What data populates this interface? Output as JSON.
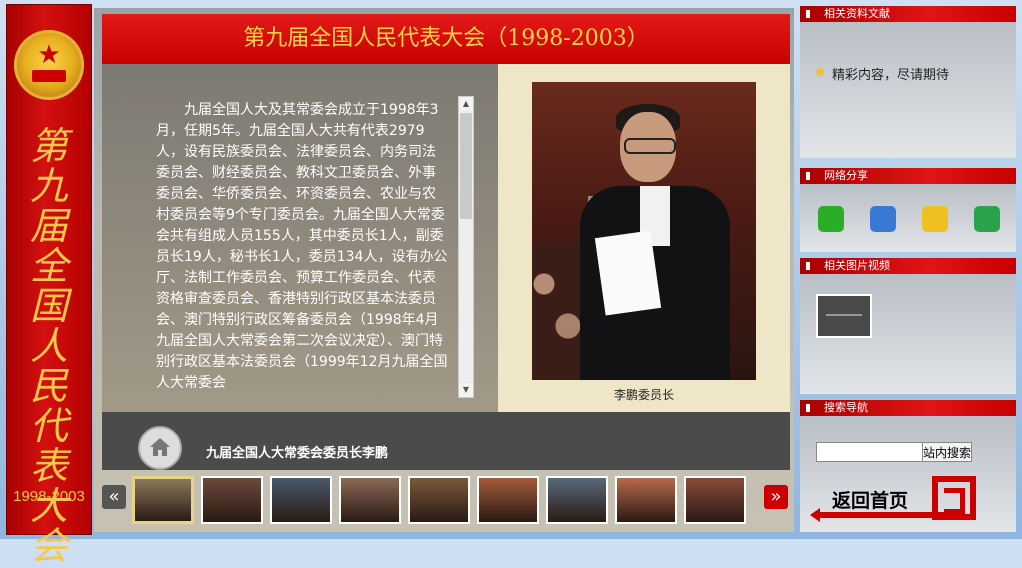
{
  "banner": {
    "vertical_title": [
      "第",
      "九",
      "届",
      "全",
      "国",
      "人",
      "民",
      "代",
      "表",
      "大",
      "会"
    ],
    "years": "1998-2003",
    "emblem_icon": "national-emblem-icon"
  },
  "main": {
    "title": "第九届全国人民代表大会（1998-2003）",
    "article": "九届全国人大及其常委会成立于1998年3月，任期5年。九届全国人大共有代表2979人，设有民族委员会、法律委员会、内务司法委员会、财经委员会、教科文卫委员会、外事委员会、华侨委员会、环资委员会、农业与农村委员会等9个专门委员会。九届全国人大常委会共有组成人员155人，其中委员长1人，副委员长19人，秘书长1人，委员134人，设有办公厅、法制工作委员会、预算工作委员会、代表资格审查委员会、香港特别行政区基本法委员会、澳门特别行政区筹备委员会（1998年4月九届全国人大常委会第二次会议决定）、澳门特别行政区基本法委员会（1999年12月九届全国人大常委会",
    "photo_caption": "李鹏委员长",
    "subtitle": "九届全国人大常委会委员长李鹏"
  },
  "thumbs": {
    "prev_label": "«",
    "next_label": "»",
    "items": [
      {
        "color": "#8a7a5c",
        "active": true
      },
      {
        "color": "#6b4a3a",
        "active": false
      },
      {
        "color": "#4a5a6a",
        "active": false
      },
      {
        "color": "#8a6a55",
        "active": false
      },
      {
        "color": "#7a5a3a",
        "active": false
      },
      {
        "color": "#a25a3a",
        "active": false
      },
      {
        "color": "#5a6a7a",
        "active": false
      },
      {
        "color": "#b86a4a",
        "active": false
      },
      {
        "color": "#8a4a3a",
        "active": false
      }
    ]
  },
  "sidebar": {
    "docs_title": "相关资料文献",
    "docs_text": "精彩内容，尽请期待",
    "share_title": "网络分享",
    "share_icons": [
      {
        "name": "wechat-icon",
        "color": "#2aae2a"
      },
      {
        "name": "qzone-icon",
        "color": "#3a7ad6"
      },
      {
        "name": "weibo-icon",
        "color": "#f0c020"
      },
      {
        "name": "share-icon",
        "color": "#2aa44a"
      }
    ],
    "media_title": "相关图片视频",
    "search_title": "搜索导航",
    "search_placeholder": "",
    "search_button": "站内搜索",
    "home_link": "返回首页"
  }
}
